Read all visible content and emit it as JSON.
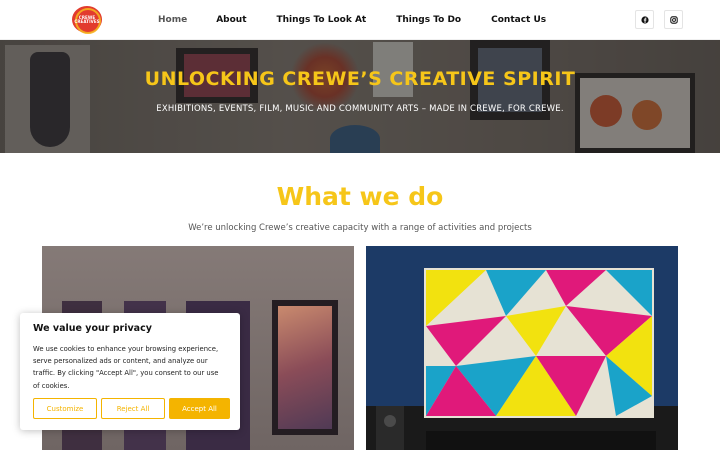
{
  "logo": {
    "text": "CREWE CREATIVES"
  },
  "nav": {
    "items": [
      {
        "label": "Home"
      },
      {
        "label": "About"
      },
      {
        "label": "Things To Look At"
      },
      {
        "label": "Things To Do"
      },
      {
        "label": "Contact Us"
      }
    ]
  },
  "social": {
    "facebook": "facebook-icon",
    "instagram": "instagram-icon"
  },
  "hero": {
    "title": "UNLOCKING CREWE’S CREATIVE SPIRIT",
    "subtitle": "EXHIBITIONS, EVENTS, FILM, MUSIC AND COMMUNITY ARTS – MADE IN CREWE, FOR CREWE."
  },
  "section": {
    "title": "What we do",
    "subtitle": "We’re unlocking Crewe’s creative capacity with a range of activities and projects"
  },
  "cookie": {
    "title": "We value your privacy",
    "text": "We use cookies to enhance your browsing experience, serve personalized ads or content, and analyze our traffic. By clicking \"Accept All\", you consent to our use of cookies.",
    "customize": "Customize",
    "reject": "Reject All",
    "accept": "Accept All"
  },
  "colors": {
    "accent": "#f6c619",
    "button": "#f4b400"
  }
}
